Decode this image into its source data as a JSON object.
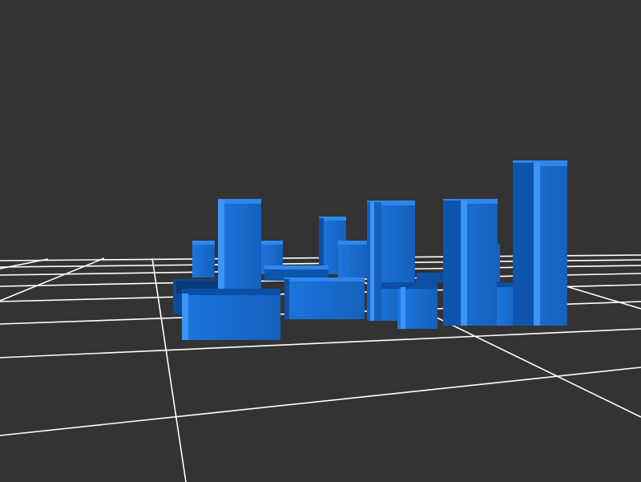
{
  "scene": {
    "background": "#333333",
    "grid_color": "#ffffff",
    "piece_colors": {
      "front": "#1a6fd6",
      "side": "#0d4fa6",
      "top": "#2f86ec",
      "highlight": "#3b95f5",
      "edge": "#0a3a7a"
    },
    "object_type": "polycube-puzzle-pieces",
    "piece_count": 9
  }
}
